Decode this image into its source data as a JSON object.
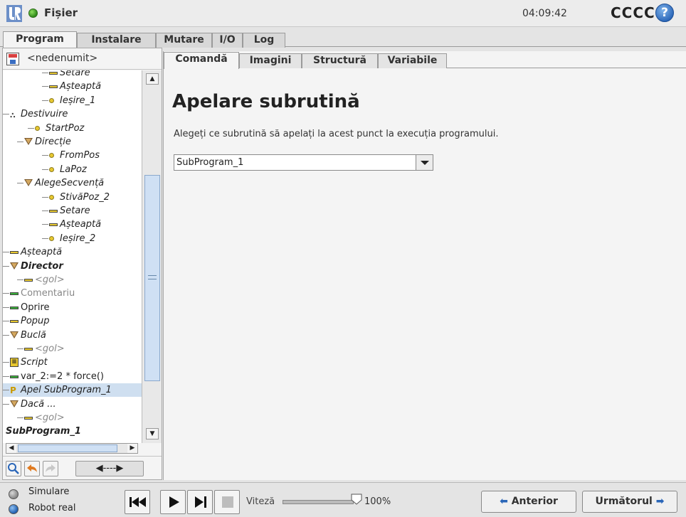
{
  "topbar": {
    "file_label": "Fișier",
    "clock": "04:09:42",
    "robot_name": "CCCC",
    "help_glyph": "?",
    "status_color": "#3a9a20"
  },
  "main_tabs": [
    {
      "label": "Program",
      "active": true
    },
    {
      "label": "Instalare",
      "active": false
    },
    {
      "label": "Mutare",
      "active": false
    },
    {
      "label": "I/O",
      "active": false
    },
    {
      "label": "Log",
      "active": false
    }
  ],
  "program": {
    "name": "<nedenumit>",
    "tree": [
      {
        "label": "Setare",
        "icon": "bar-yellow",
        "italic": true
      },
      {
        "label": "Așteaptă",
        "icon": "bar-yellow",
        "italic": true
      },
      {
        "label": "Ieșire_1",
        "icon": "dot",
        "italic": true
      },
      {
        "label": "Destivuire",
        "icon": "dots",
        "italic": true
      },
      {
        "label": "StartPoz",
        "icon": "dot",
        "italic": true
      },
      {
        "label": "Direcție",
        "icon": "triangle",
        "italic": true
      },
      {
        "label": "FromPos",
        "icon": "dot",
        "italic": true
      },
      {
        "label": "LaPoz",
        "icon": "dot",
        "italic": true
      },
      {
        "label": "AlegeSecvență",
        "icon": "triangle",
        "italic": true
      },
      {
        "label": "StivăPoz_2",
        "icon": "dot",
        "italic": true
      },
      {
        "label": "Setare",
        "icon": "bar-yellow",
        "italic": true
      },
      {
        "label": "Așteaptă",
        "icon": "bar-yellow",
        "italic": true
      },
      {
        "label": "Ieșire_2",
        "icon": "dot",
        "italic": true
      },
      {
        "label": "Așteaptă",
        "icon": "bar-yellow",
        "italic": true
      },
      {
        "label": "Director",
        "icon": "triangle",
        "italic": true,
        "bold": true
      },
      {
        "label": "<gol>",
        "icon": "bar-yellow",
        "italic": true,
        "gray": true
      },
      {
        "label": "Comentariu",
        "icon": "bar-green",
        "gray": true
      },
      {
        "label": "Oprire",
        "icon": "bar-green"
      },
      {
        "label": "Popup",
        "icon": "bar-yellow",
        "italic": true
      },
      {
        "label": "Buclă",
        "icon": "triangle",
        "italic": true
      },
      {
        "label": "<gol>",
        "icon": "bar-yellow",
        "italic": true,
        "gray": true
      },
      {
        "label": "Script",
        "icon": "script",
        "italic": true
      },
      {
        "label": "var_2:=2 * force()",
        "icon": "bar-green"
      },
      {
        "label": "Apel SubProgram_1",
        "icon": "call",
        "italic": true,
        "selected": true
      },
      {
        "label": "Dacă ...",
        "icon": "triangle",
        "italic": true
      },
      {
        "label": "<gol>",
        "icon": "bar-yellow",
        "italic": true,
        "gray": true
      },
      {
        "label": "SubProgram_1",
        "icon": "none",
        "italic": true,
        "bold": true
      }
    ],
    "move_label": "◀----▶"
  },
  "sub_tabs": [
    {
      "label": "Comandă",
      "active": true
    },
    {
      "label": "Imagini",
      "active": false
    },
    {
      "label": "Structură",
      "active": false
    },
    {
      "label": "Variabile",
      "active": false
    }
  ],
  "command": {
    "title": "Apelare subrutină",
    "description": "Alegeți ce subrutină să apelați la acest punct la execuția programului.",
    "subroutine_selected": "SubProgram_1"
  },
  "bottombar": {
    "mode_simulation": "Simulare",
    "mode_real": "Robot real",
    "speed_label": "Viteză",
    "speed_value": "100%",
    "speed_fraction": 1.0,
    "prev_label": "Anterior",
    "next_label": "Următorul"
  }
}
